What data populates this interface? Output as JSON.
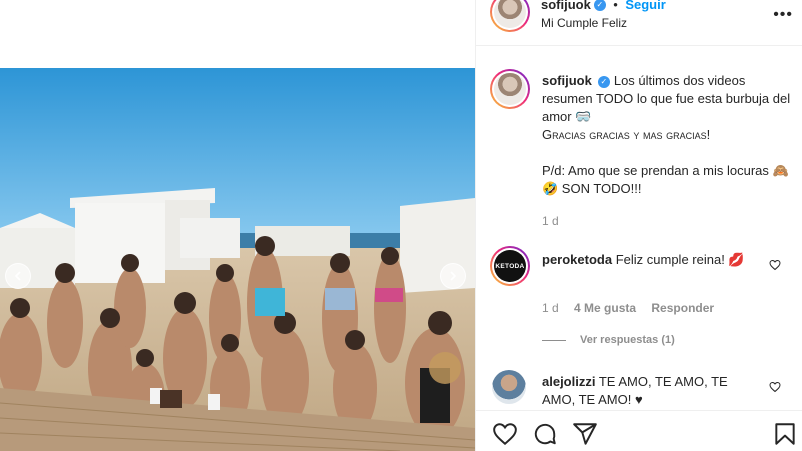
{
  "post_header": {
    "username": "sofijuok",
    "follow_label": "Seguir",
    "separator": "•",
    "location": "Mi Cumple Feliz",
    "more_label": "•••"
  },
  "caption": {
    "username": "sofijuok",
    "line1": "Los últimos dos videos resumen TODO lo que fue esta burbuja del amor 🥽",
    "line2": "Gracias gracias y mas gracias!",
    "line3": "P/d: Amo que se prendan a mis locuras 🙈🤣 SON TODO!!!",
    "time": "1 d"
  },
  "comments": [
    {
      "username": "peroketoda",
      "avatar_text": "KETODA",
      "text": "Feliz cumple reina! 💋",
      "time": "1 d",
      "likes": "4 Me gusta",
      "reply_label": "Responder",
      "view_replies": "Ver respuestas (1)"
    },
    {
      "username": "alejolizzi",
      "text": "TE AMO, TE AMO, TE AMO, TE AMO! ♥"
    }
  ],
  "icons": {
    "like": "heart-icon",
    "comment": "comment-icon",
    "share": "share-icon",
    "save": "bookmark-icon"
  },
  "colors": {
    "link_blue": "#0095f6",
    "verified_blue": "#3897f0",
    "border": "#efefef",
    "muted": "#8e8e8e"
  }
}
